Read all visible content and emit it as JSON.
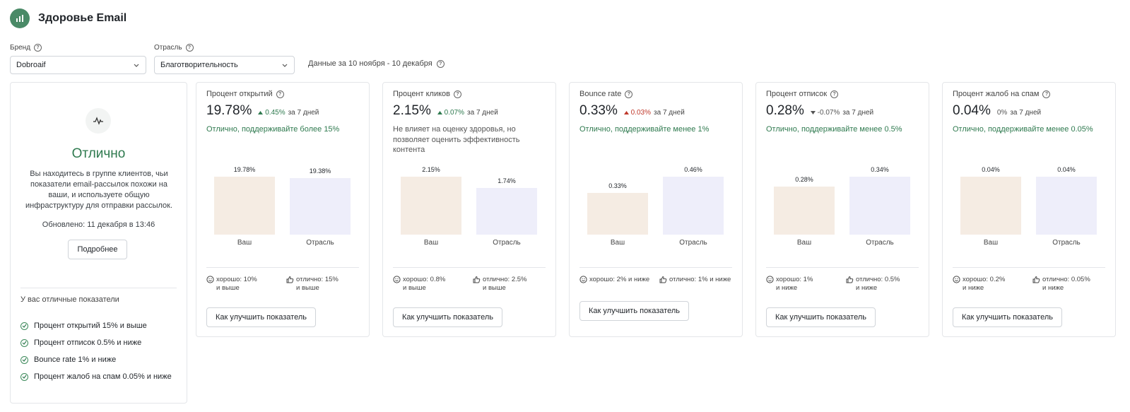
{
  "header": {
    "title": "Здоровье Email",
    "logo_icon": "bar-chart-icon"
  },
  "filters": {
    "brand": {
      "label": "Бренд",
      "value": "Dobroaif"
    },
    "industry": {
      "label": "Отрасль",
      "value": "Благотворительность"
    },
    "date_range": "Данные за 10 ноября - 10 декабря"
  },
  "summary": {
    "status": "Отлично",
    "description": "Вы находитесь в группе клиентов, чьи показатели email-рассылок похожи на ваши, и используете общую инфраструктуру для отправки рассылок.",
    "updated": "Обновлено: 11 декабря в 13:46",
    "more_button": "Подробнее",
    "good_title": "У вас отличные показатели",
    "good_items": [
      "Процент открытий 15% и выше",
      "Процент отписок 0.5% и ниже",
      "Bounce rate 1% и ниже",
      "Процент жалоб на спам 0.05% и ниже"
    ],
    "colors": {
      "good": "#2f7a4f"
    }
  },
  "metrics": [
    {
      "title": "Процент открытий",
      "value": "19.78%",
      "trend": "0.45%",
      "trend_direction": "up",
      "period": "за 7 дней",
      "advice": "Отлично, поддерживайте более 15%",
      "advice_tone": "good",
      "chart_data": {
        "type": "bar",
        "categories": [
          "Ваш",
          "Отрасль"
        ],
        "values": [
          19.78,
          19.38
        ],
        "value_labels": [
          "19.78%",
          "19.38%"
        ]
      },
      "threshold_good": "хорошо: 10%\nи выше",
      "threshold_excellent": "отлично: 15%\nи выше",
      "button": "Как улучшить показатель"
    },
    {
      "title": "Процент кликов",
      "value": "2.15%",
      "trend": "0.07%",
      "trend_direction": "up",
      "period": "за 7 дней",
      "advice": "Не влияет на оценку здоровья, но позволяет оценить эффективность контента",
      "advice_tone": "neutral",
      "chart_data": {
        "type": "bar",
        "categories": [
          "Ваш",
          "Отрасль"
        ],
        "values": [
          2.15,
          1.74
        ],
        "value_labels": [
          "2.15%",
          "1.74%"
        ]
      },
      "threshold_good": "хорошо: 0.8%\nи выше",
      "threshold_excellent": "отлично: 2.5%\nи выше",
      "button": "Как улучшить показатель"
    },
    {
      "title": "Bounce rate",
      "value": "0.33%",
      "trend": "0.03%",
      "trend_direction": "up-bad",
      "period": "за 7 дней",
      "advice": "Отлично, поддерживайте менее 1%",
      "advice_tone": "good",
      "chart_data": {
        "type": "bar",
        "categories": [
          "Ваш",
          "Отрасль"
        ],
        "values": [
          0.33,
          0.46
        ],
        "value_labels": [
          "0.33%",
          "0.46%"
        ]
      },
      "threshold_good": "хорошо: 2% и ниже",
      "threshold_excellent": "отлично: 1% и ниже",
      "button": "Как улучшить показатель"
    },
    {
      "title": "Процент отписок",
      "value": "0.28%",
      "trend": "-0.07%",
      "trend_direction": "down",
      "period": "за 7 дней",
      "advice": "Отлично, поддерживайте менее 0.5%",
      "advice_tone": "good",
      "chart_data": {
        "type": "bar",
        "categories": [
          "Ваш",
          "Отрасль"
        ],
        "values": [
          0.28,
          0.34
        ],
        "value_labels": [
          "0.28%",
          "0.34%"
        ]
      },
      "threshold_good": "хорошо: 1%\nи ниже",
      "threshold_excellent": "отлично: 0.5%\nи ниже",
      "button": "Как улучшить показатель"
    },
    {
      "title": "Процент жалоб на спам",
      "value": "0.04%",
      "trend": "0%",
      "trend_direction": "flat",
      "period": "за 7 дней",
      "advice": "Отлично, поддерживайте менее 0.05%",
      "advice_tone": "good",
      "chart_data": {
        "type": "bar",
        "categories": [
          "Ваш",
          "Отрасль"
        ],
        "values": [
          0.04,
          0.04
        ],
        "value_labels": [
          "0.04%",
          "0.04%"
        ]
      },
      "threshold_good": "хорошо: 0.2%\nи ниже",
      "threshold_excellent": "отлично: 0.05%\nи ниже",
      "button": "Как улучшить показатель"
    }
  ]
}
